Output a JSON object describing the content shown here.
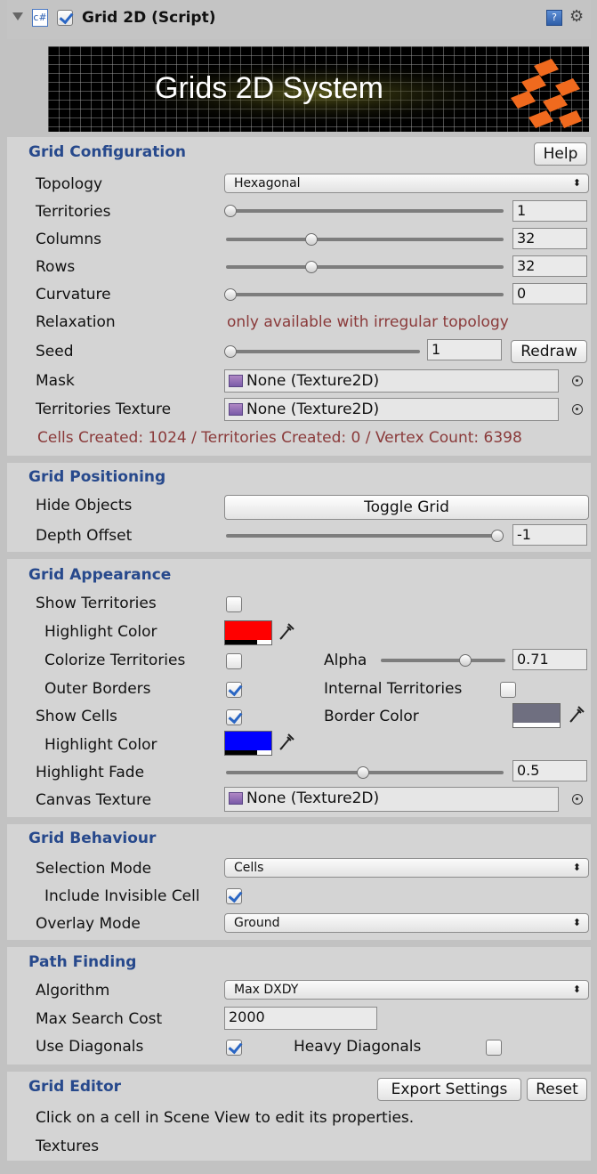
{
  "header": {
    "title": "Grid 2D (Script)",
    "enabled": true
  },
  "banner": {
    "text": "Grids 2D System"
  },
  "grid_configuration": {
    "title": "Grid Configuration",
    "help_label": "Help",
    "topology_label": "Topology",
    "topology_value": "Hexagonal",
    "territories_label": "Territories",
    "territories_value": "1",
    "territories_slider": 0.0,
    "columns_label": "Columns",
    "columns_value": "32",
    "columns_slider": 0.31,
    "rows_label": "Rows",
    "rows_value": "32",
    "rows_slider": 0.31,
    "curvature_label": "Curvature",
    "curvature_value": "0",
    "curvature_slider": 0.0,
    "relaxation_label": "Relaxation",
    "relaxation_note": "only available with irregular topology",
    "seed_label": "Seed",
    "seed_value": "1",
    "seed_slider": 0.0,
    "redraw_label": "Redraw",
    "mask_label": "Mask",
    "mask_value": "None (Texture2D)",
    "territories_texture_label": "Territories Texture",
    "territories_texture_value": "None (Texture2D)",
    "stats": "Cells Created: 1024 / Territories Created: 0 / Vertex Count: 6398"
  },
  "grid_positioning": {
    "title": "Grid Positioning",
    "hide_objects_label": "Hide Objects",
    "toggle_grid_label": "Toggle Grid",
    "depth_offset_label": "Depth Offset",
    "depth_offset_value": "-1",
    "depth_offset_slider": 1.0
  },
  "grid_appearance": {
    "title": "Grid Appearance",
    "show_territories_label": "Show Territories",
    "show_territories": false,
    "territory_highlight_label": "Highlight Color",
    "territory_highlight_color": "#ff0000",
    "colorize_label": "Colorize Territories",
    "colorize": false,
    "alpha_label": "Alpha",
    "alpha_value": "0.71",
    "alpha_slider": 0.71,
    "outer_borders_label": "Outer Borders",
    "outer_borders": true,
    "internal_territories_label": "Internal Territories",
    "internal_territories": false,
    "show_cells_label": "Show Cells",
    "show_cells": true,
    "border_color_label": "Border Color",
    "border_color": "#6f6f80",
    "cell_highlight_label": "Highlight Color",
    "cell_highlight_color": "#0000ff",
    "highlight_fade_label": "Highlight Fade",
    "highlight_fade_value": "0.5",
    "highlight_fade_slider": 0.5,
    "canvas_texture_label": "Canvas Texture",
    "canvas_texture_value": "None (Texture2D)"
  },
  "grid_behaviour": {
    "title": "Grid Behaviour",
    "selection_mode_label": "Selection Mode",
    "selection_mode_value": "Cells",
    "include_invisible_label": "Include Invisible Cell",
    "include_invisible": true,
    "overlay_mode_label": "Overlay Mode",
    "overlay_mode_value": "Ground"
  },
  "path_finding": {
    "title": "Path Finding",
    "algorithm_label": "Algorithm",
    "algorithm_value": "Max DXDY",
    "max_search_cost_label": "Max Search Cost",
    "max_search_cost_value": "2000",
    "use_diagonals_label": "Use Diagonals",
    "use_diagonals": true,
    "heavy_diagonals_label": "Heavy Diagonals",
    "heavy_diagonals": false
  },
  "grid_editor": {
    "title": "Grid Editor",
    "export_label": "Export Settings",
    "reset_label": "Reset",
    "hint": "Click on a cell in Scene View to edit its properties.",
    "textures_label": "Textures"
  }
}
